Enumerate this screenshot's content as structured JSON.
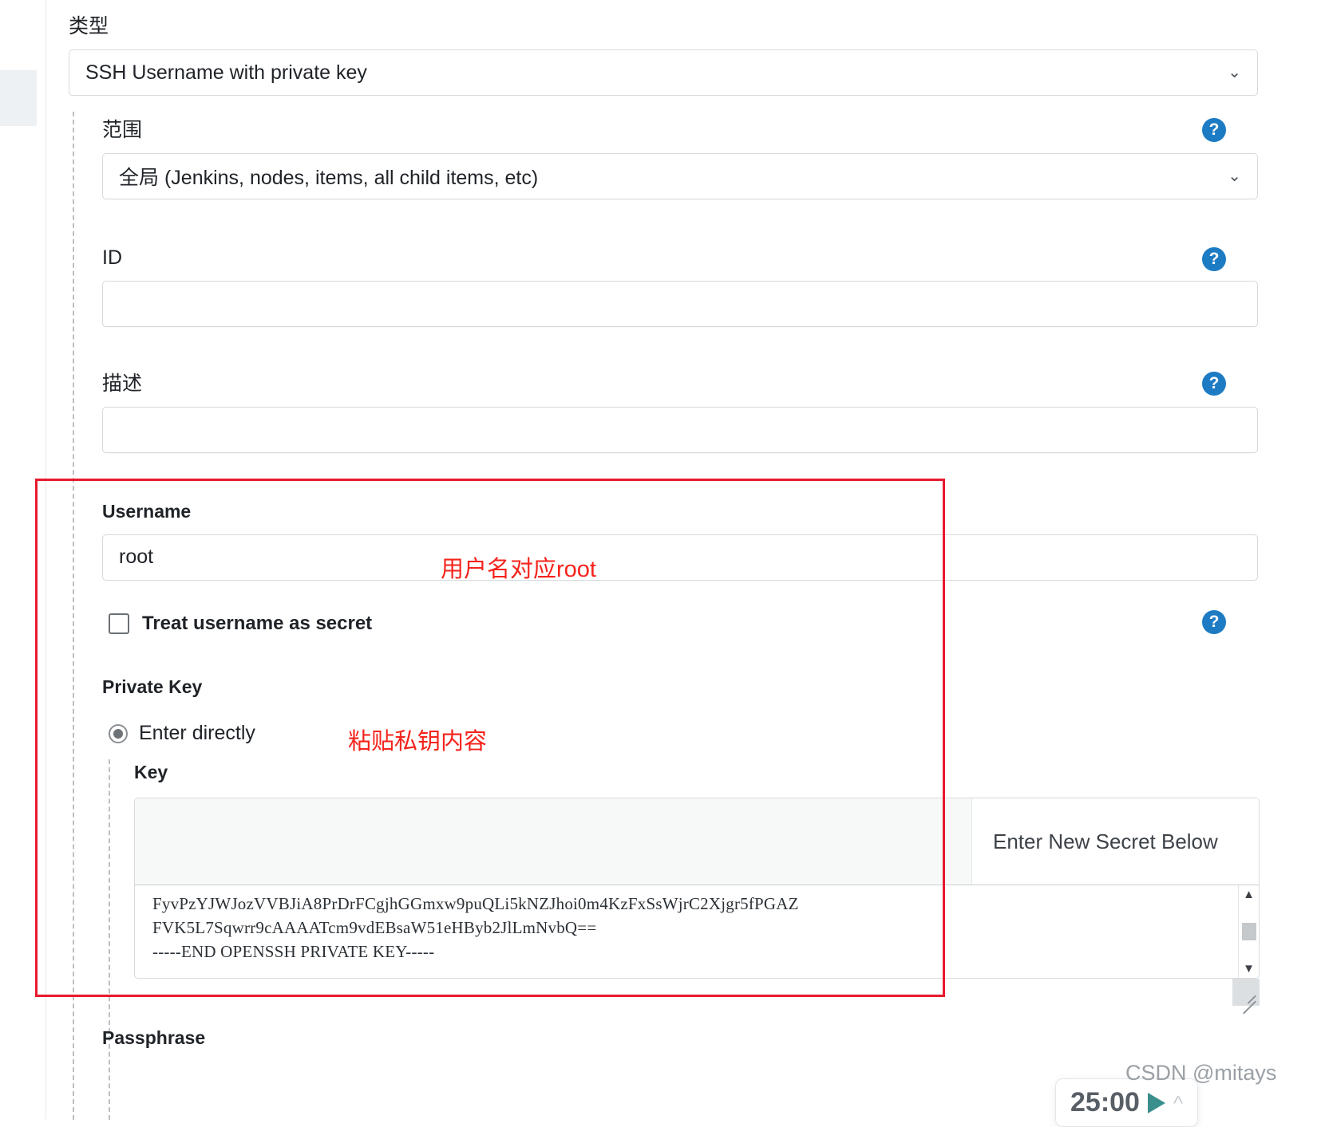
{
  "form": {
    "type_label": "类型",
    "type_value": "SSH Username with private key",
    "scope_label": "范围",
    "scope_value_cn": "全局",
    "scope_value_en": " (Jenkins, nodes, items, all child items, etc)",
    "id_label": "ID",
    "id_value": "",
    "description_label": "描述",
    "description_value": "",
    "username_label": "Username",
    "username_value": "root",
    "treat_secret_label": "Treat username as secret",
    "private_key_label": "Private Key",
    "enter_directly_label": "Enter directly",
    "key_label": "Key",
    "key_secret_note": "Enter New Secret Below",
    "key_line_1": "FyvPzYJWJozVVBJiA8PrDrFCgjhGGmxw9puQLi5kNZJhoi0m4KzFxSsWjrC2Xjgr5fPGAZ",
    "key_line_2": "FVK5L7Sqwrr9cAAAATcm9vdEBsaW51eHByb2JlLmNvbQ==",
    "key_line_3": "-----END OPENSSH PRIVATE KEY-----",
    "passphrase_label": "Passphrase",
    "help_icon": "?",
    "chevron_icon": "⌄",
    "scroll_up_icon": "▲",
    "scroll_down_icon": "▼"
  },
  "annotations": {
    "username_note": "用户名对应root",
    "private_key_note": "粘贴私钥内容",
    "box_color": "#e8192c",
    "note_color": "#f5231c"
  },
  "timer": {
    "time": "25:00",
    "play_icon": "play-icon",
    "caret_icon": "chevron-up-icon"
  },
  "watermark": {
    "text": "CSDN @mitays"
  }
}
